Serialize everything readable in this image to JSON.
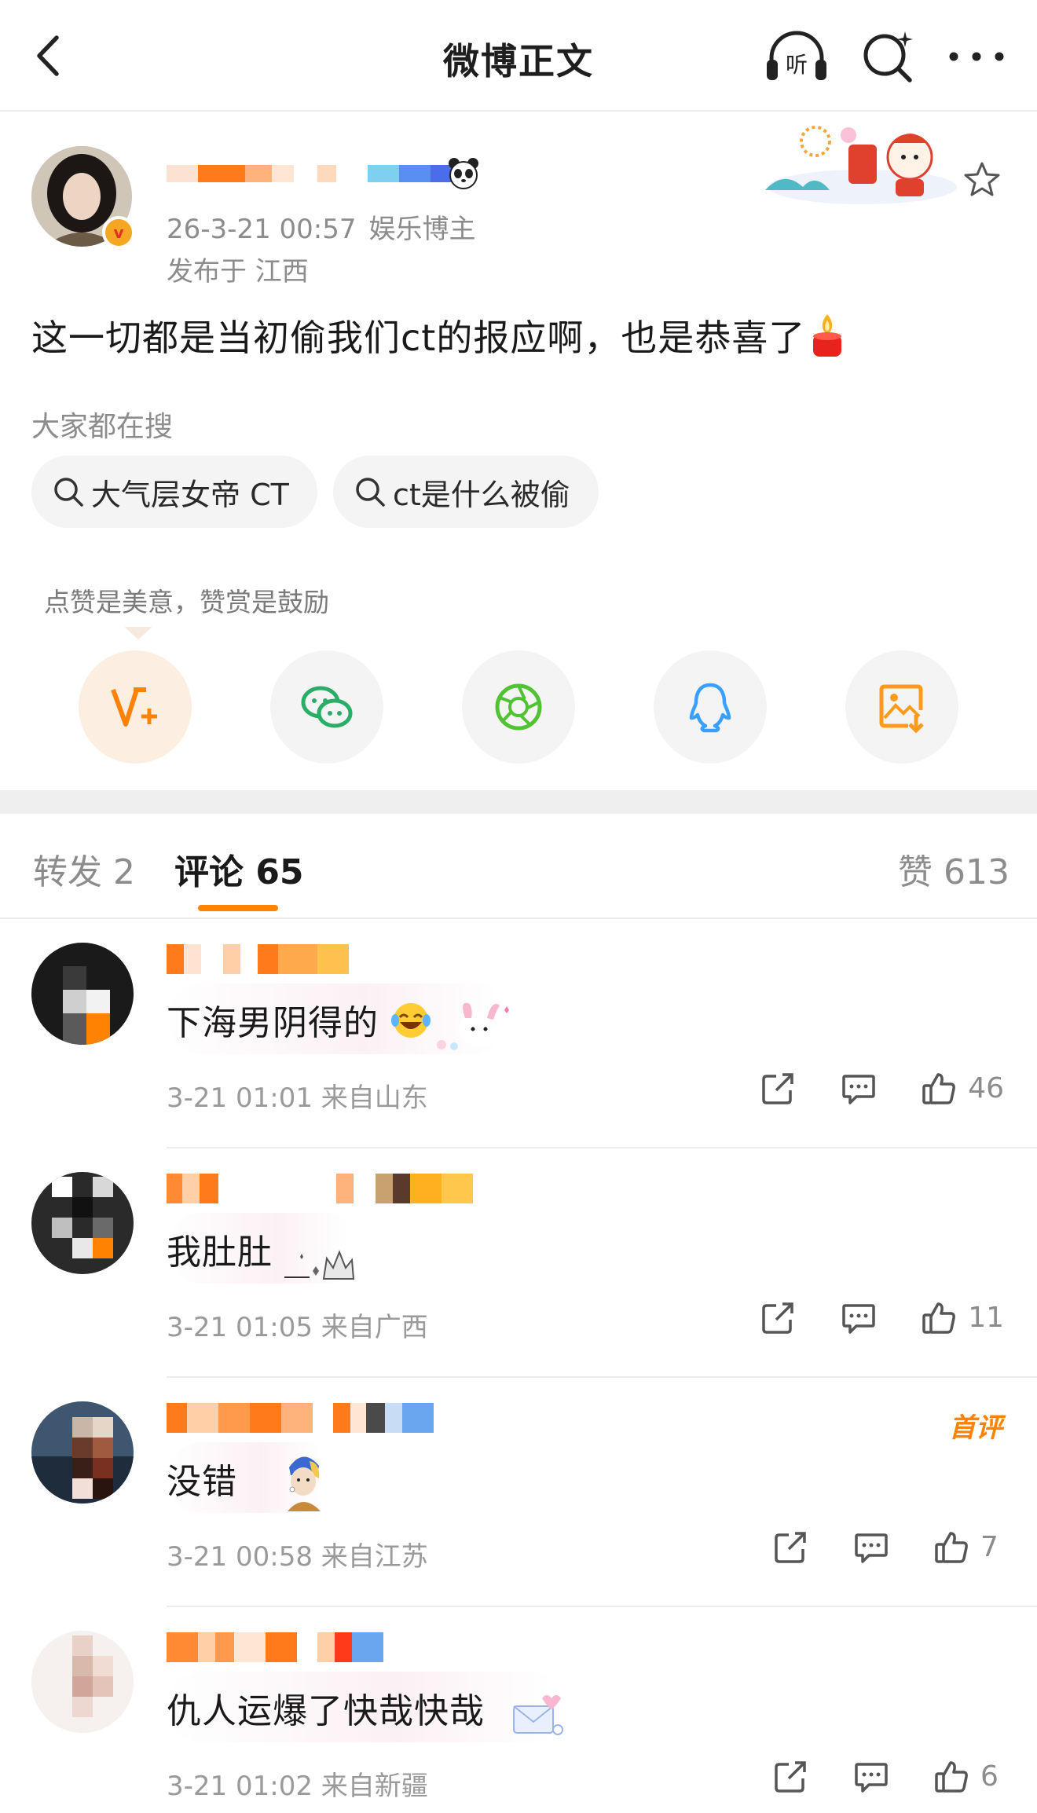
{
  "header": {
    "title": "微博正文",
    "listen_label": "听"
  },
  "post": {
    "time": "26-3-21 00:57",
    "role": "娱乐博主",
    "location": "发布于 江西",
    "content": "这一切都是当初偷我们ct的报应啊，也是恭喜了",
    "verify_mark": "v"
  },
  "hot_search": {
    "label": "大家都在搜",
    "chips": [
      "大气层女帝 CT",
      "ct是什么被偷"
    ]
  },
  "like_hint": "点赞是美意，赞赏是鼓励",
  "tabs": {
    "repost": "转发 2",
    "comments": "评论 65",
    "likes": "赞 613"
  },
  "comments": [
    {
      "text": "下海男阴得的",
      "meta": "3-21 01:01  来自山东",
      "likes": "46"
    },
    {
      "text": "我肚肚",
      "meta": "3-21 01:05  来自广西",
      "likes": "11"
    },
    {
      "text": "没错",
      "meta": "3-21 00:58  来自江苏",
      "likes": "7",
      "badge": "首评"
    },
    {
      "text": "仇人运爆了快哉快哉",
      "meta": "3-21 01:02  来自新疆",
      "likes": "6"
    }
  ],
  "colors": {
    "accent": "#ff8200",
    "muted_text": "#8c8c8c",
    "wechat_green": "#2aae67",
    "moments_green": "#51c332",
    "qq_blue": "#3aa0ff"
  }
}
